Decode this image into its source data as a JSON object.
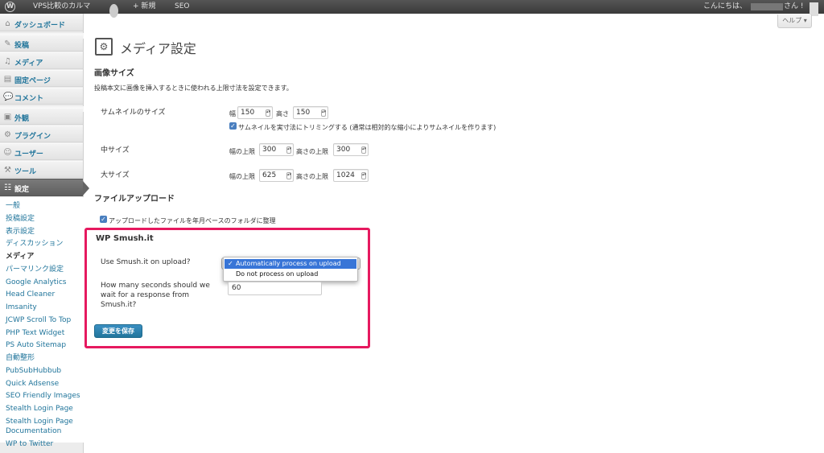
{
  "admin_bar": {
    "logo": "W",
    "site_name": "VPS比較のカルマ",
    "comments_icon": "comment-bubble-icon",
    "new_label": "+ 新規",
    "seo_label": "SEO",
    "greeting": "こんにちは、",
    "greeting_suffix": "さん !"
  },
  "help_tab": "ヘルプ ▾",
  "sidebar": {
    "items": [
      {
        "label": "ダッシュボード",
        "icon": "⌂"
      },
      {
        "label": "投稿",
        "icon": "✎"
      },
      {
        "label": "メディア",
        "icon": "♫"
      },
      {
        "label": "固定ページ",
        "icon": "▤"
      },
      {
        "label": "コメント",
        "icon": "💬"
      },
      {
        "label": "外観",
        "icon": "▣"
      },
      {
        "label": "プラグイン",
        "icon": "⚙"
      },
      {
        "label": "ユーザー",
        "icon": "☺"
      },
      {
        "label": "ツール",
        "icon": "⚒"
      },
      {
        "label": "設定",
        "icon": "☷"
      }
    ],
    "submenu": [
      "一般",
      "投稿設定",
      "表示設定",
      "ディスカッション",
      "メディア",
      "パーマリンク設定",
      "Google Analytics",
      "Head Cleaner",
      "Imsanity",
      "JCWP Scroll To Top",
      "PHP Text Widget",
      "PS Auto Sitemap",
      "自動整形",
      "PubSubHubbub",
      "Quick Adsense",
      "SEO Friendly Images",
      "Stealth Login Page",
      "Stealth Login Page",
      "Documentation",
      "WP to Twitter"
    ]
  },
  "page": {
    "title": "メディア設定",
    "image_size_title": "画像サイズ",
    "image_size_desc": "投稿本文に画像を挿入するときに使われる上限寸法を設定できます。",
    "thumbnail": {
      "label": "サムネイルのサイズ",
      "width_label": "幅",
      "width": "150",
      "height_label": "高さ",
      "height": "150",
      "crop_label": "サムネイルを実寸法にトリミングする (通常は相対的な縮小によりサムネイルを作ります)"
    },
    "medium": {
      "label": "中サイズ",
      "max_width_label": "幅の上限",
      "max_width": "300",
      "max_height_label": "高さの上限",
      "max_height": "300"
    },
    "large": {
      "label": "大サイズ",
      "max_width_label": "幅の上限",
      "max_width": "625",
      "max_height_label": "高さの上限",
      "max_height": "1024"
    },
    "upload_title": "ファイルアップロード",
    "upload_checkbox_label": "アップロードしたファイルを年月ベースのフォルダに整理",
    "smush": {
      "title": "WP Smush.it",
      "on_upload_label": "Use Smush.it on upload?",
      "options": [
        "Automatically process on upload",
        "Do not process on upload"
      ],
      "selected_index": 0,
      "timeout_label_1": "How many seconds should we",
      "timeout_label_2": "wait for a response from",
      "timeout_label_3": "Smush.it?",
      "timeout_value": "60"
    },
    "save_button": "変更を保存"
  },
  "colors": {
    "link": "#21759b",
    "highlight_border": "#e6195f",
    "admin_bar": "#464646",
    "dropdown_selected": "#3875d7"
  }
}
